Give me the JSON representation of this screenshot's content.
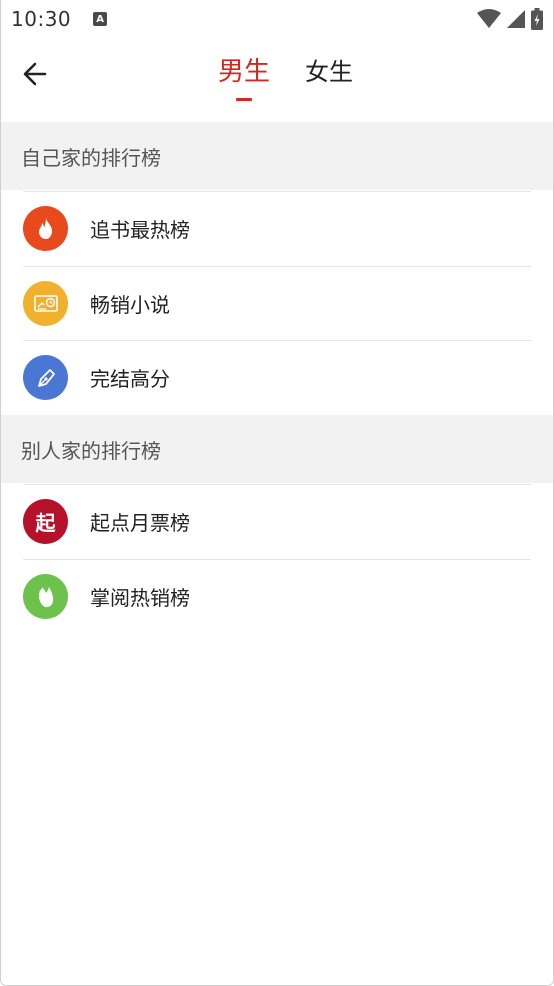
{
  "status_bar": {
    "time": "10:30",
    "notification_badge": "A",
    "icons": [
      "wifi-icon",
      "signal-icon",
      "battery-icon"
    ]
  },
  "header": {
    "back_icon": "arrow-left-icon",
    "tabs": [
      {
        "label": "男生",
        "active": true
      },
      {
        "label": "女生",
        "active": false
      }
    ],
    "accent_color": "#d7261d"
  },
  "sections": [
    {
      "title": "自己家的排行榜",
      "items": [
        {
          "label": "追书最热榜",
          "icon": "flame-icon",
          "icon_color": "#e8491d"
        },
        {
          "label": "畅销小说",
          "icon": "sales-chart-icon",
          "icon_color": "#f2b12c"
        },
        {
          "label": "完结高分",
          "icon": "pen-nib-icon",
          "icon_color": "#4a77d4"
        }
      ]
    },
    {
      "title": "别人家的排行榜",
      "items": [
        {
          "label": "起点月票榜",
          "icon": "qidian-logo-icon",
          "icon_color": "#b5122a",
          "icon_text": "起"
        },
        {
          "label": "掌阅热销榜",
          "icon": "leaf-icon",
          "icon_color": "#6cc24a"
        }
      ]
    }
  ]
}
